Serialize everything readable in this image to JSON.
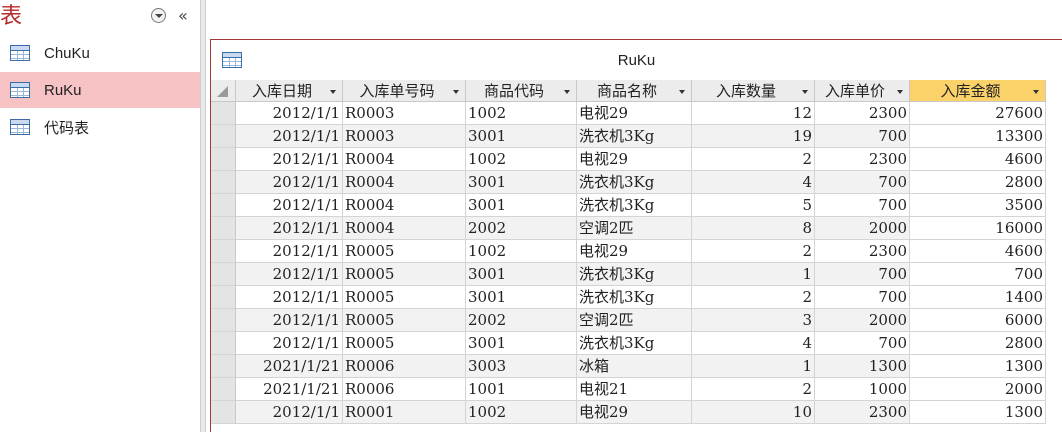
{
  "nav": {
    "title": "表",
    "items": [
      {
        "label": "ChuKu",
        "icon": "table-icon"
      },
      {
        "label": "RuKu",
        "icon": "table-icon",
        "selected": true
      },
      {
        "label": "代码表",
        "icon": "table-icon"
      }
    ],
    "menu_icon": "circle-dropdown-icon",
    "collapse_glyph": "«"
  },
  "document": {
    "title": "RuKu",
    "columns": [
      "入库日期",
      "入库单号码",
      "商品代码",
      "商品名称",
      "入库数量",
      "入库单价",
      "入库金额"
    ],
    "sorted_column_color": "#fbd26a",
    "rows": [
      [
        "2012/1/1",
        "R0003",
        "1002",
        "电视29",
        "12",
        "2300",
        "27600"
      ],
      [
        "2012/1/1",
        "R0003",
        "3001",
        "洗衣机3Kg",
        "19",
        "700",
        "13300"
      ],
      [
        "2012/1/1",
        "R0004",
        "1002",
        "电视29",
        "2",
        "2300",
        "4600"
      ],
      [
        "2012/1/1",
        "R0004",
        "3001",
        "洗衣机3Kg",
        "4",
        "700",
        "2800"
      ],
      [
        "2012/1/1",
        "R0004",
        "3001",
        "洗衣机3Kg",
        "5",
        "700",
        "3500"
      ],
      [
        "2012/1/1",
        "R0004",
        "2002",
        "空调2匹",
        "8",
        "2000",
        "16000"
      ],
      [
        "2012/1/1",
        "R0005",
        "1002",
        "电视29",
        "2",
        "2300",
        "4600"
      ],
      [
        "2012/1/1",
        "R0005",
        "3001",
        "洗衣机3Kg",
        "1",
        "700",
        "700"
      ],
      [
        "2012/1/1",
        "R0005",
        "3001",
        "洗衣机3Kg",
        "2",
        "700",
        "1400"
      ],
      [
        "2012/1/1",
        "R0005",
        "2002",
        "空调2匹",
        "3",
        "2000",
        "6000"
      ],
      [
        "2012/1/1",
        "R0005",
        "3001",
        "洗衣机3Kg",
        "4",
        "700",
        "2800"
      ],
      [
        "2021/1/21",
        "R0006",
        "3003",
        "冰箱",
        "1",
        "1300",
        "1300"
      ],
      [
        "2021/1/21",
        "R0006",
        "1001",
        "电视21",
        "2",
        "1000",
        "2000"
      ],
      [
        "2012/1/1",
        "R0001",
        "1002",
        "电视29",
        "10",
        "2300",
        "1300"
      ]
    ]
  }
}
